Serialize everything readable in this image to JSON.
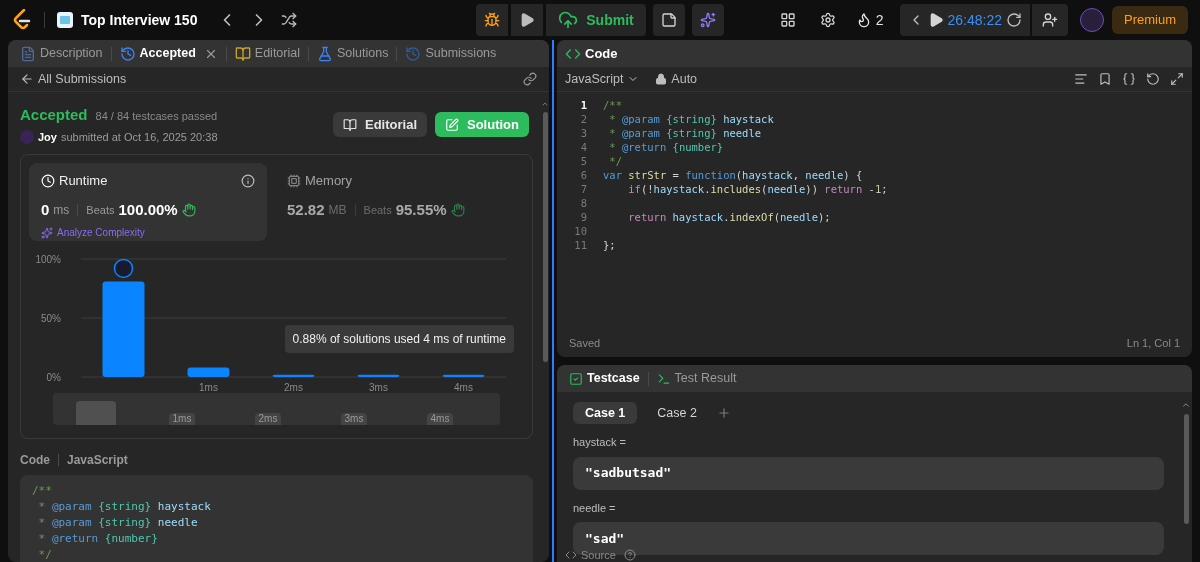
{
  "topbar": {
    "problem_list": "Top Interview 150",
    "submit": "Submit",
    "streak": "2",
    "timer": "26:48:22",
    "premium": "Premium"
  },
  "left_panel": {
    "tabs": [
      {
        "label": "Description",
        "kind": "description",
        "selected": false,
        "closable": false
      },
      {
        "label": "Accepted",
        "kind": "accepted",
        "selected": true,
        "closable": true
      },
      {
        "label": "Editorial",
        "kind": "editorial",
        "selected": false,
        "closable": false
      },
      {
        "label": "Solutions",
        "kind": "solutions",
        "selected": false,
        "closable": false
      },
      {
        "label": "Submissions",
        "kind": "submissions",
        "selected": false,
        "closable": false
      }
    ],
    "back_link": "All Submissions",
    "submission": {
      "status": "Accepted",
      "testcases": "84 / 84 testcases passed",
      "user": "Joy",
      "submitted": "submitted at Oct 16, 2025 20:38"
    },
    "buttons": [
      {
        "label": "Editorial",
        "kind": "editorial"
      },
      {
        "label": "Solution",
        "kind": "solution"
      }
    ],
    "stats": [
      {
        "kind": "runtime",
        "title": "Runtime",
        "value": "0",
        "unit": "ms",
        "beats_label": "Beats",
        "beats": "100.00%",
        "selected": true
      },
      {
        "kind": "memory",
        "title": "Memory",
        "value": "52.82",
        "unit": "MB",
        "beats_label": "Beats",
        "beats": "95.55%",
        "selected": false
      }
    ],
    "analyze": "Analyze Complexity",
    "chart_data": {
      "type": "bar",
      "categories": [
        null,
        "1ms",
        "2ms",
        "3ms",
        "4ms"
      ],
      "values": [
        81,
        8,
        2,
        2,
        2
      ],
      "ylim": [
        0,
        100
      ],
      "yticks": [
        {
          "value": 0,
          "label": "0%"
        },
        {
          "value": 50,
          "label": "50%"
        },
        {
          "value": 100,
          "label": "100%"
        }
      ],
      "annotations": [
        "0.88% of solutions used 4 ms of runtime"
      ]
    },
    "overview_labels": [
      "1ms",
      "2ms",
      "3ms",
      "4ms"
    ],
    "code_label": "Code",
    "code_language": "JavaScript",
    "code_lines": [
      [
        {
          "text": "/**",
          "kind": "comment"
        }
      ],
      [
        {
          "text": " * ",
          "kind": "comment"
        },
        {
          "text": "@param",
          "kind": "tag"
        },
        {
          "text": " {string}",
          "kind": "type"
        },
        {
          "text": " haystack",
          "kind": "ident"
        }
      ],
      [
        {
          "text": " * ",
          "kind": "comment"
        },
        {
          "text": "@param",
          "kind": "tag"
        },
        {
          "text": " {string}",
          "kind": "type"
        },
        {
          "text": " needle",
          "kind": "ident"
        }
      ],
      [
        {
          "text": " * ",
          "kind": "comment"
        },
        {
          "text": "@return",
          "kind": "tag"
        },
        {
          "text": " {number}",
          "kind": "type"
        }
      ],
      [
        {
          "text": " */",
          "kind": "comment"
        }
      ]
    ]
  },
  "editor": {
    "title": "Code",
    "language": "JavaScript",
    "mode": "Auto",
    "status": "Saved",
    "cursor": "Ln 1, Col 1",
    "lines": [
      {
        "number": "1",
        "active": true,
        "tokens": [
          {
            "text": "/**",
            "kind": "comment"
          }
        ]
      },
      {
        "number": "2",
        "active": false,
        "tokens": [
          {
            "text": " * ",
            "kind": "comment"
          },
          {
            "text": "@param",
            "kind": "tag"
          },
          {
            "text": " {string}",
            "kind": "type"
          },
          {
            "text": " haystack",
            "kind": "ident"
          }
        ]
      },
      {
        "number": "3",
        "active": false,
        "tokens": [
          {
            "text": " * ",
            "kind": "comment"
          },
          {
            "text": "@param",
            "kind": "tag"
          },
          {
            "text": " {string}",
            "kind": "type"
          },
          {
            "text": " needle",
            "kind": "ident"
          }
        ]
      },
      {
        "number": "4",
        "active": false,
        "tokens": [
          {
            "text": " * ",
            "kind": "comment"
          },
          {
            "text": "@return",
            "kind": "tag"
          },
          {
            "text": " {number}",
            "kind": "type"
          }
        ]
      },
      {
        "number": "5",
        "active": false,
        "tokens": [
          {
            "text": " */",
            "kind": "comment"
          }
        ]
      },
      {
        "number": "6",
        "active": false,
        "tokens": [
          {
            "text": "var",
            "kind": "keyword"
          },
          {
            "text": " strStr",
            "kind": "fn"
          },
          {
            "text": " = ",
            "kind": "plain"
          },
          {
            "text": "function",
            "kind": "keyword"
          },
          {
            "text": "(",
            "kind": "plain"
          },
          {
            "text": "haystack",
            "kind": "ident"
          },
          {
            "text": ", ",
            "kind": "plain"
          },
          {
            "text": "needle",
            "kind": "ident"
          },
          {
            "text": ") {",
            "kind": "plain"
          }
        ]
      },
      {
        "number": "7",
        "active": false,
        "tokens": [
          {
            "text": "    if",
            "kind": "ctrl"
          },
          {
            "text": "(!",
            "kind": "plain"
          },
          {
            "text": "haystack",
            "kind": "ident"
          },
          {
            "text": ".",
            "kind": "plain"
          },
          {
            "text": "includes",
            "kind": "fn"
          },
          {
            "text": "(",
            "kind": "plain"
          },
          {
            "text": "needle",
            "kind": "ident"
          },
          {
            "text": ")) ",
            "kind": "plain"
          },
          {
            "text": "return",
            "kind": "ctrl"
          },
          {
            "text": " -",
            "kind": "plain"
          },
          {
            "text": "1",
            "kind": "number"
          },
          {
            "text": ";",
            "kind": "plain"
          }
        ]
      },
      {
        "number": "8",
        "active": false
      },
      {
        "number": "9",
        "active": false,
        "tokens": [
          {
            "text": "    return ",
            "kind": "ctrl"
          },
          {
            "text": "haystack",
            "kind": "ident"
          },
          {
            "text": ".",
            "kind": "plain"
          },
          {
            "text": "indexOf",
            "kind": "fn"
          },
          {
            "text": "(",
            "kind": "plain"
          },
          {
            "text": "needle",
            "kind": "ident"
          },
          {
            "text": ");",
            "kind": "plain"
          }
        ]
      },
      {
        "number": "10",
        "active": false
      },
      {
        "number": "11",
        "active": false,
        "tokens": [
          {
            "text": "};",
            "kind": "plain"
          }
        ]
      }
    ]
  },
  "testcase_panel": {
    "tabs": [
      {
        "label": "Testcase",
        "kind": "testcase",
        "selected": true
      },
      {
        "label": "Test Result",
        "kind": "result",
        "selected": false
      }
    ],
    "cases": [
      {
        "label": "Case 1",
        "selected": true
      },
      {
        "label": "Case 2",
        "selected": false
      }
    ],
    "params": [
      {
        "name": "haystack =",
        "value": "\"sadbutsad\""
      },
      {
        "name": "needle =",
        "value": "\"sad\""
      }
    ],
    "footer": "Source"
  }
}
